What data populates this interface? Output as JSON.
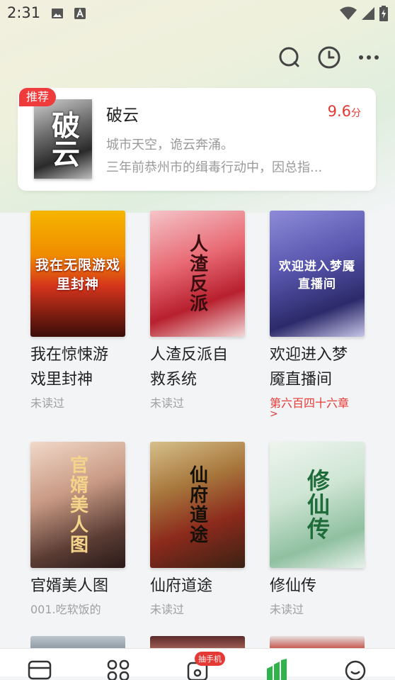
{
  "status": {
    "time": "2:31"
  },
  "actions": {
    "search_icon": "search-icon",
    "history_icon": "clock-icon",
    "more_icon": "more-dots-icon"
  },
  "recommend": {
    "badge": "推荐",
    "cover_text": "破云",
    "title": "破云",
    "score": "9.6",
    "score_unit": "分",
    "desc1": "城市天空，诡云奔涌。",
    "desc2": "三年前恭州市的缉毒行动中，因总指..."
  },
  "books": [
    {
      "cover_text": "我在无限游戏里封神",
      "title1": "我在惊悚游",
      "title2": "戏里封神",
      "sub": "未读过",
      "sub_red": false
    },
    {
      "cover_text": "人渣反派",
      "title1": "人渣反派自",
      "title2": "救系统",
      "sub": "未读过",
      "sub_red": false
    },
    {
      "cover_text": "欢迎进入梦魇直播间",
      "title1": "欢迎进入梦",
      "title2": "魇直播间",
      "sub": "第六百四十六章",
      "sub_red": true
    },
    {
      "cover_text": "官婿美人图",
      "title1": "官婿美人图",
      "title2": "",
      "sub": "001.吃软饭的",
      "sub_red": false
    },
    {
      "cover_text": "仙府道途",
      "title1": "仙府道途",
      "title2": "",
      "sub": "未读过",
      "sub_red": false
    },
    {
      "cover_text": "修仙传",
      "title1": "修仙传",
      "title2": "",
      "sub": "未读过",
      "sub_red": false
    }
  ],
  "nav": {
    "badge": "抽手机"
  },
  "colors": {
    "accent_red": "#e53935",
    "accent_green": "#2fb34a"
  }
}
